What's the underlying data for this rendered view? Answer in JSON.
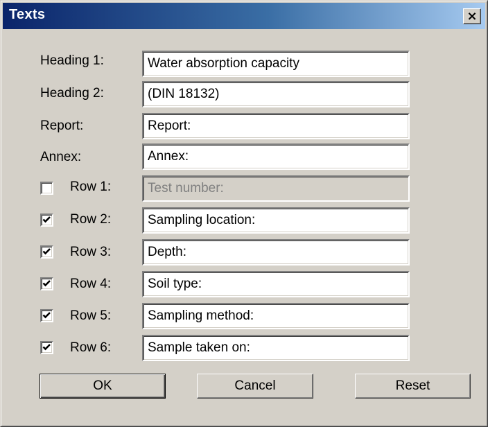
{
  "window": {
    "title": "Texts",
    "close_label": "×"
  },
  "headings": [
    {
      "label": "Heading 1:",
      "value": "Water absorption capacity"
    },
    {
      "label": "Heading 2:",
      "value": "(DIN 18132)"
    },
    {
      "label": "Report:",
      "value": "Report:"
    },
    {
      "label": "Annex:",
      "value": "Annex:"
    }
  ],
  "rows": [
    {
      "label": "Row 1:",
      "value": "Test number:",
      "checked": false,
      "enabled": false
    },
    {
      "label": "Row 2:",
      "value": "Sampling location:",
      "checked": true,
      "enabled": true
    },
    {
      "label": "Row 3:",
      "value": "Depth:",
      "checked": true,
      "enabled": true
    },
    {
      "label": "Row 4:",
      "value": "Soil type:",
      "checked": true,
      "enabled": true
    },
    {
      "label": "Row 5:",
      "value": "Sampling method:",
      "checked": true,
      "enabled": true
    },
    {
      "label": "Row 6:",
      "value": "Sample taken on:",
      "checked": true,
      "enabled": true
    }
  ],
  "buttons": {
    "ok": "OK",
    "cancel": "Cancel",
    "reset": "Reset"
  }
}
